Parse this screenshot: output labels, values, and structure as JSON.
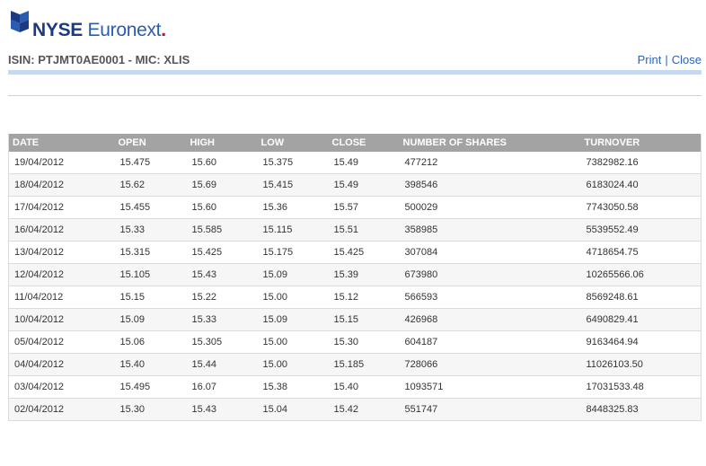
{
  "brand": {
    "name_part1": "NYSE",
    "name_part2": "Euronext",
    "name_dot": "."
  },
  "header": {
    "isin_line": "ISIN: PTJMT0AE0001 - MIC: XLIS",
    "print_label": "Print",
    "separator": "|",
    "close_label": "Close"
  },
  "colors": {
    "header_bg": "#a3a3a3",
    "link": "#2a64b4",
    "accent_bar": "#c6d9ef",
    "brand_blue": "#1d3a80",
    "brand_red": "#e2001a"
  },
  "icons": {
    "logo": "nyse-euronext-logo-icon"
  },
  "table": {
    "columns": [
      "DATE",
      "OPEN",
      "HIGH",
      "LOW",
      "CLOSE",
      "NUMBER OF SHARES",
      "TURNOVER"
    ],
    "rows": [
      [
        "19/04/2012",
        "15.475",
        "15.60",
        "15.375",
        "15.49",
        "477212",
        "7382982.16"
      ],
      [
        "18/04/2012",
        "15.62",
        "15.69",
        "15.415",
        "15.49",
        "398546",
        "6183024.40"
      ],
      [
        "17/04/2012",
        "15.455",
        "15.60",
        "15.36",
        "15.57",
        "500029",
        "7743050.58"
      ],
      [
        "16/04/2012",
        "15.33",
        "15.585",
        "15.115",
        "15.51",
        "358985",
        "5539552.49"
      ],
      [
        "13/04/2012",
        "15.315",
        "15.425",
        "15.175",
        "15.425",
        "307084",
        "4718654.75"
      ],
      [
        "12/04/2012",
        "15.105",
        "15.43",
        "15.09",
        "15.39",
        "673980",
        "10265566.06"
      ],
      [
        "11/04/2012",
        "15.15",
        "15.22",
        "15.00",
        "15.12",
        "566593",
        "8569248.61"
      ],
      [
        "10/04/2012",
        "15.09",
        "15.33",
        "15.09",
        "15.15",
        "426968",
        "6490829.41"
      ],
      [
        "05/04/2012",
        "15.06",
        "15.305",
        "15.00",
        "15.30",
        "604187",
        "9163464.94"
      ],
      [
        "04/04/2012",
        "15.40",
        "15.44",
        "15.00",
        "15.185",
        "728066",
        "11026103.50"
      ],
      [
        "03/04/2012",
        "15.495",
        "16.07",
        "15.38",
        "15.40",
        "1093571",
        "17031533.48"
      ],
      [
        "02/04/2012",
        "15.30",
        "15.43",
        "15.04",
        "15.42",
        "551747",
        "8448325.83"
      ]
    ]
  }
}
